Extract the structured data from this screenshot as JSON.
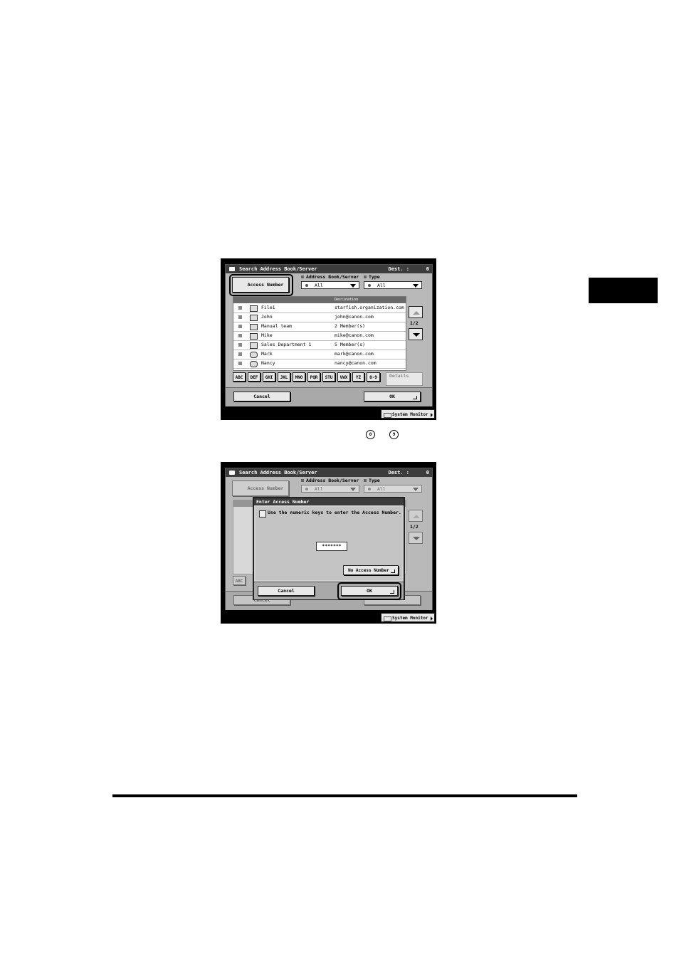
{
  "screen1": {
    "title": "Search Address Book/Server",
    "dest_label": "Dest. :",
    "dest_value": "0",
    "access_number_button": "Access Number",
    "address_book_label": "Address Book/Server",
    "address_book_value": "All",
    "type_label": "Type",
    "type_value": "All",
    "list_header_destination": "Destination",
    "rows": [
      {
        "name": "File1",
        "destination": "starfish.organization.com",
        "icon": "file-server-icon"
      },
      {
        "name": "John",
        "destination": "john@canon.com",
        "icon": "email-icon"
      },
      {
        "name": "Manual team",
        "destination": "2 Member(s)",
        "icon": "group-icon"
      },
      {
        "name": "Mike",
        "destination": "mike@canon.com",
        "icon": "email-icon"
      },
      {
        "name": "Sales Department 1",
        "destination": "5 Member(s)",
        "icon": "group-icon"
      },
      {
        "name": "Mark",
        "destination": "mark@canon.com",
        "icon": "i-fax-icon"
      },
      {
        "name": "Nancy",
        "destination": "nancy@canon.com",
        "icon": "i-fax-icon"
      }
    ],
    "page_indicator": "1/2",
    "alpha_keys": [
      "ABC",
      "DEF",
      "GHI",
      "JKL",
      "MNO",
      "PQR",
      "STU",
      "VWX",
      "YZ",
      "0-9"
    ],
    "details_button": "Details",
    "cancel_button": "Cancel",
    "ok_button": "OK",
    "system_monitor": "System Monitor"
  },
  "key_icons": [
    "0",
    "9"
  ],
  "screen2": {
    "title": "Search Address Book/Server",
    "dest_label": "Dest. :",
    "dest_value": "0",
    "access_number_button": "Access Number",
    "address_book_label": "Address Book/Server",
    "address_book_value": "All",
    "type_label": "Type",
    "type_value": "All",
    "page_indicator": "1/2",
    "alpha_first": "ABC",
    "background_cancel": "Cancel",
    "dialog": {
      "title": "Enter Access Number",
      "instruction": "Use the numeric keys to enter the Access Number.",
      "password_mask": "*******",
      "no_access_number_button": "No Access Number",
      "cancel_button": "Cancel",
      "ok_button": "OK"
    },
    "system_monitor": "System Monitor"
  }
}
